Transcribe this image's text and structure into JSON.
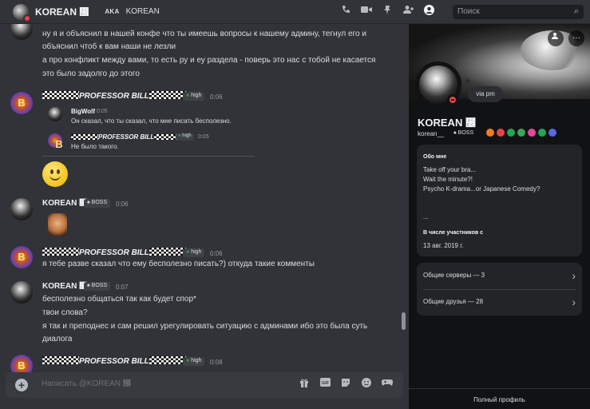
{
  "header": {
    "name": "KOREAN ᲼",
    "aka_label": "AKA",
    "aka_value": "KOREAN",
    "search_placeholder": "Поиск",
    "icons": [
      "phone-icon",
      "video-icon",
      "pin-icon",
      "add-member-icon",
      "profile-icon"
    ]
  },
  "messages": {
    "m1_line1": "ну я и объяснил в нашей конфе что ты имеешь вопросы к нашему админу, тегнул его и",
    "m1_line2": "объяснил чтоб к вам наши не лезли",
    "m1_line3": "а про конфликт между вами, то есть ру и еу раздела - поверь это нас с тобой не касается",
    "m1_line4": "это было задолго до этого",
    "bill_name": "PROFESSOR BILL",
    "bill_badge": "high",
    "m2_time": "0:06",
    "reply1_name": "BigWolf",
    "reply1_time": "0:05",
    "reply1_text": "Он сказал, что ты сказал, что мне писать бесполезно.",
    "reply2_name": "PROFESSOR BILL",
    "reply2_badge": "high",
    "reply2_time": "0:05",
    "reply2_text": "Не было такого.",
    "korean_name": "KOREAN ᲼",
    "korean_badge": "BOSS",
    "m3_time": "0:06",
    "m4_time": "0:06",
    "m4_text": "я тебе разве сказал что ему бесполезно писать?) откуда такие комменты",
    "m5_time": "0:07",
    "m5_line1": "бесполезно общаться так как будет спор*",
    "m5_line2": "твои слова?",
    "m5_line3": "я так и преподнес и сам решил урегулировать ситуацию с админами ибо это была суть",
    "m5_line4": "диалога",
    "m6_time": "0:08"
  },
  "composer": {
    "placeholder": "Написать @KOREAN ᲼",
    "icons": [
      "gift-icon",
      "gif-icon",
      "sticker-icon",
      "emoji-icon",
      "game-icon"
    ]
  },
  "profile": {
    "status": "via pm",
    "display_name": "KOREAN ᲼",
    "username": "korean__",
    "role_badge": "BOSS",
    "about_title": "Обо мне",
    "about_line1": "Take off your bra...",
    "about_line2": "Wait the minute?!",
    "about_line3": "Psycho K-drama...or Japanese Comedy?",
    "about_line4": "...",
    "member_since_title": "В числе участников с",
    "member_since": "13 авг. 2019 г.",
    "mutual_servers": "Общие серверы — 3",
    "mutual_friends": "Общие друзья — 28",
    "full_profile": "Полный профиль",
    "badge_colors": [
      "#f47b20",
      "#ed4245",
      "#23a55a",
      "#3ba55c",
      "#eb459e",
      "#23a55a",
      "#5865f2"
    ]
  }
}
